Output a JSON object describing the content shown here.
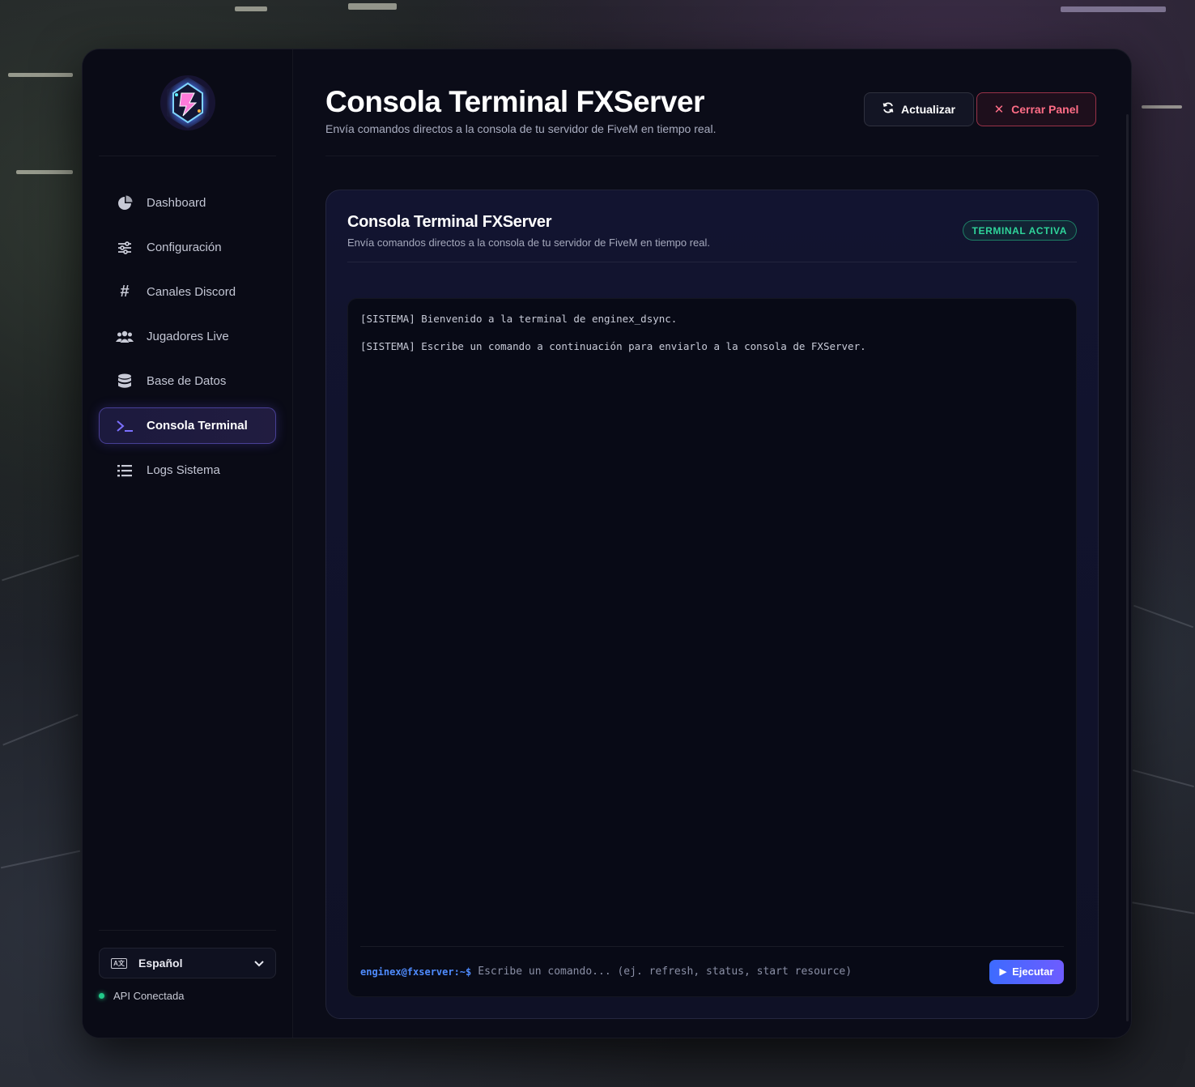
{
  "sidebar": {
    "items": [
      {
        "label": "Dashboard",
        "icon": "pie-chart-icon"
      },
      {
        "label": "Configuración",
        "icon": "sliders-icon"
      },
      {
        "label": "Canales Discord",
        "icon": "hashtag-icon"
      },
      {
        "label": "Jugadores Live",
        "icon": "users-icon"
      },
      {
        "label": "Base de Datos",
        "icon": "database-icon"
      },
      {
        "label": "Consola Terminal",
        "icon": "terminal-icon",
        "active": true
      },
      {
        "label": "Logs Sistema",
        "icon": "list-icon"
      }
    ],
    "language": {
      "selected": "Español",
      "icon": "language-icon"
    },
    "api_status": {
      "label": "API Conectada",
      "color": "#22c98a"
    }
  },
  "header": {
    "title": "Consola Terminal FXServer",
    "subtitle": "Envía comandos directos a la consola de tu servidor de FiveM en tiempo real.",
    "refresh_label": "Actualizar",
    "close_label": "Cerrar Panel"
  },
  "card": {
    "title": "Consola Terminal FXServer",
    "subtitle": "Envía comandos directos a la consola de tu servidor de FiveM en tiempo real.",
    "badge": "TERMINAL ACTIVA"
  },
  "terminal": {
    "lines": [
      "[SISTEMA] Bienvenido a la terminal de enginex_dsync.",
      "[SISTEMA] Escribe un comando a continuación para enviarlo a la consola de FXServer."
    ],
    "prompt": "enginex@fxserver:~$",
    "placeholder": "Escribe un comando... (ej. refresh, status, start resource)",
    "value": "",
    "run_label": "Ejecutar"
  },
  "colors": {
    "accent": "#7b70ff",
    "danger": "#ff6d86",
    "success": "#2fd49a",
    "prompt": "#4f8cff"
  }
}
